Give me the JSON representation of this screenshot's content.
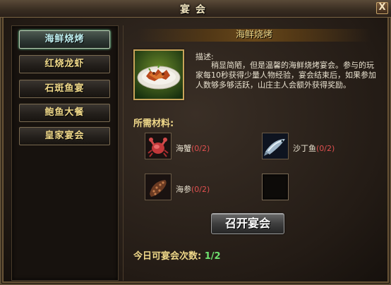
{
  "window": {
    "title": "宴会",
    "close_label": "X"
  },
  "menu": {
    "items": [
      {
        "label": "海鲜烧烤",
        "active": true
      },
      {
        "label": "红烧龙虾",
        "active": false
      },
      {
        "label": "石斑鱼宴",
        "active": false
      },
      {
        "label": "鲍鱼大餐",
        "active": false
      },
      {
        "label": "皇家宴会",
        "active": false
      }
    ]
  },
  "detail": {
    "title": "海鲜烧烤",
    "desc_label": "描述:",
    "desc_text": "稍显简陋，但是温馨的海鲜烧烤宴会。参与的玩家每10秒获得少量人物经验，宴会结束后，如果参加人数够多够活跃，山庄主人会额外获得奖励。",
    "materials_label": "所需材料:",
    "materials": [
      {
        "name": "海蟹",
        "count": "(0/2)",
        "icon": "crab-icon"
      },
      {
        "name": "沙丁鱼",
        "count": "(0/2)",
        "icon": "sardine-icon"
      },
      {
        "name": "海参",
        "count": "(0/2)",
        "icon": "sea-cucumber-icon"
      }
    ],
    "open_button": "召开宴会",
    "times_label": "今日可宴会次数:",
    "times_value": "1/2"
  },
  "colors": {
    "accent_gold": "#f0d98a",
    "count_red": "#e05050",
    "count_green": "#6fe06f",
    "active_tab_text": "#bfeff0"
  }
}
